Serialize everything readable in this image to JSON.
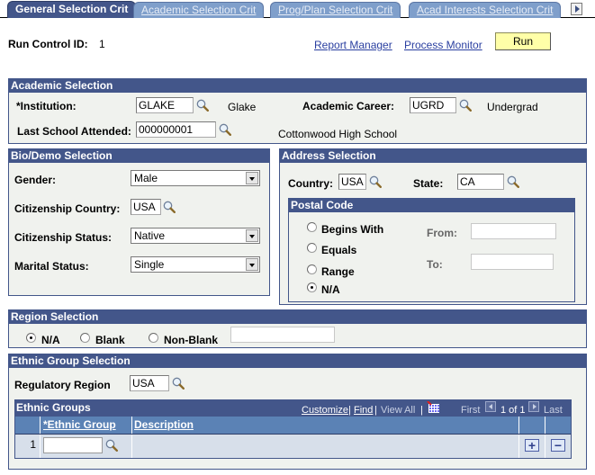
{
  "tabs": [
    {
      "label": "General Selection Crit",
      "active": true
    },
    {
      "label": "Academic Selection Crit",
      "active": false
    },
    {
      "label": "Prog/Plan Selection Crit",
      "active": false
    },
    {
      "label": "Acad Interests Selection Crit",
      "active": false
    }
  ],
  "header": {
    "run_control_label": "Run Control ID:",
    "run_control_value": "1",
    "report_manager": "Report Manager",
    "process_monitor": "Process Monitor",
    "run_button": "Run"
  },
  "academic": {
    "title": "Academic Selection",
    "institution_label": "*Institution:",
    "institution_value": "GLAKE",
    "institution_desc": "Glake",
    "career_label": "Academic Career:",
    "career_value": "UGRD",
    "career_desc": "Undergrad",
    "last_school_label": "Last School Attended:",
    "last_school_value": "000000001",
    "last_school_desc": "Cottonwood High School"
  },
  "bio": {
    "title": "Bio/Demo Selection",
    "gender_label": "Gender:",
    "gender_value": "Male",
    "cit_country_label": "Citizenship Country:",
    "cit_country_value": "USA",
    "cit_status_label": "Citizenship Status:",
    "cit_status_value": "Native",
    "marital_label": "Marital Status:",
    "marital_value": "Single"
  },
  "address": {
    "title": "Address Selection",
    "country_label": "Country:",
    "country_value": "USA",
    "state_label": "State:",
    "state_value": "CA",
    "postal": {
      "title": "Postal Code",
      "options": [
        {
          "label": "Begins With",
          "selected": false
        },
        {
          "label": "Equals",
          "selected": false
        },
        {
          "label": "Range",
          "selected": false
        },
        {
          "label": "N/A",
          "selected": true
        }
      ],
      "from_label": "From:",
      "from_value": "",
      "to_label": "To:",
      "to_value": ""
    }
  },
  "region": {
    "title": "Region Selection",
    "options": [
      {
        "label": "N/A",
        "selected": true
      },
      {
        "label": "Blank",
        "selected": false
      },
      {
        "label": "Non-Blank",
        "selected": false
      }
    ],
    "value": ""
  },
  "ethnic": {
    "title": "Ethnic Group Selection",
    "reg_region_label": "Regulatory Region",
    "reg_region_value": "USA",
    "grid": {
      "title": "Ethnic Groups",
      "customize": "Customize",
      "find": "Find",
      "view_all": "View All",
      "first": "First",
      "page_info": "1 of 1",
      "last": "Last",
      "columns": [
        "*Ethnic Group",
        "Description"
      ],
      "rows": [
        {
          "num": "1",
          "ethnic_group": "",
          "description": ""
        }
      ]
    }
  },
  "colors": {
    "header_bg": "#43568a",
    "panel_bg": "#f0f2ee",
    "run_button_bg": "#ffffa8",
    "link": "#2a3fa0"
  }
}
